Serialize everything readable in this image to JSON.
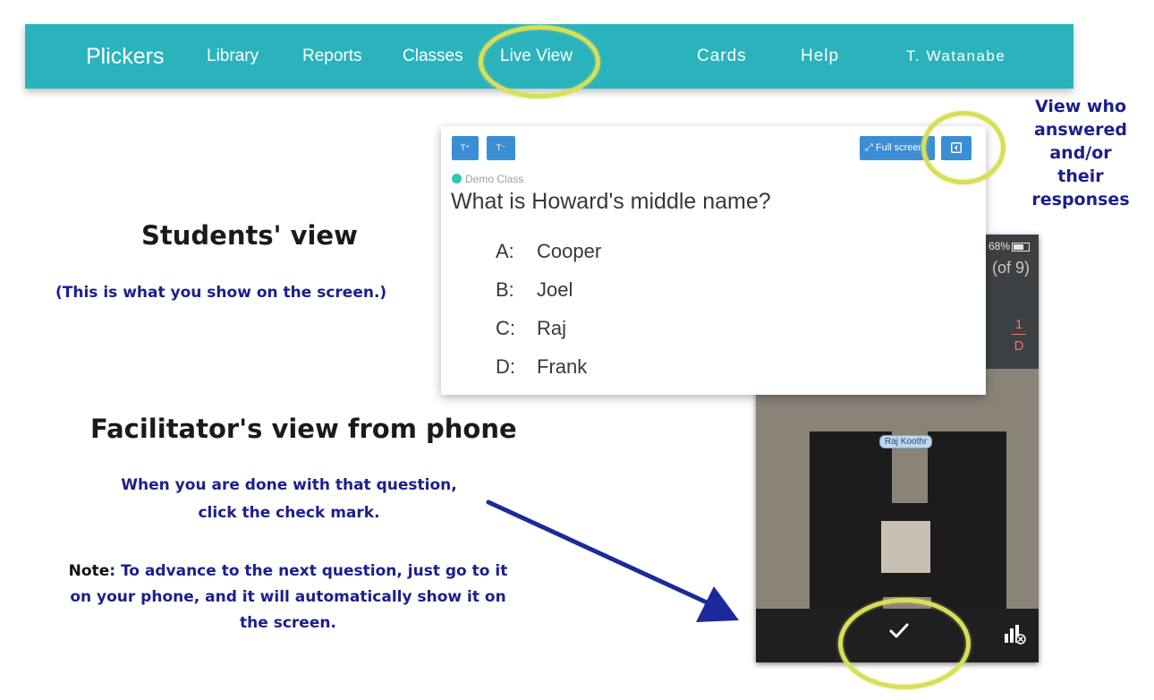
{
  "nav": {
    "brand": "Plickers",
    "items": [
      "Library",
      "Reports",
      "Classes",
      "Live View",
      "Cards",
      "Help",
      "T. Watanabe"
    ]
  },
  "student_view": {
    "font_up_label": "T⁺",
    "font_down_label": "T⁻",
    "fullscreen_label": "⤢ Full screen",
    "class_name": "Demo Class",
    "question": "What is Howard's middle name?",
    "choices": [
      {
        "letter": "A:",
        "text": "Cooper"
      },
      {
        "letter": "B:",
        "text": "Joel"
      },
      {
        "letter": "C:",
        "text": "Raj"
      },
      {
        "letter": "D:",
        "text": "Frank"
      }
    ]
  },
  "phone": {
    "battery": "68%",
    "count": "(of 9)",
    "fraction_num": "1",
    "fraction_den": "D",
    "student_name": "Raj Koothr"
  },
  "annotations": {
    "students_view_title": "Students' view",
    "students_view_note": "(This is what you show on the screen.)",
    "facilitator_title": "Facilitator's view from phone",
    "checkmark_line1": "When you are done with that question,",
    "checkmark_line2": "click the check mark.",
    "note_label": "Note",
    "note_line1": ": To advance to the next question, just go to it",
    "note_line2": "on your phone, and it will automatically show it on",
    "note_line3": "the screen.",
    "view_who_line1": "View who",
    "view_who_line2": "answered",
    "view_who_line3": "and/or",
    "view_who_line4": "their",
    "view_who_line5": "responses"
  },
  "colors": {
    "nav_bg": "#2ab3bc",
    "button_blue": "#3b8ed3",
    "highlight": "#d7df5a",
    "annotation_blue": "#1a1f8c"
  }
}
